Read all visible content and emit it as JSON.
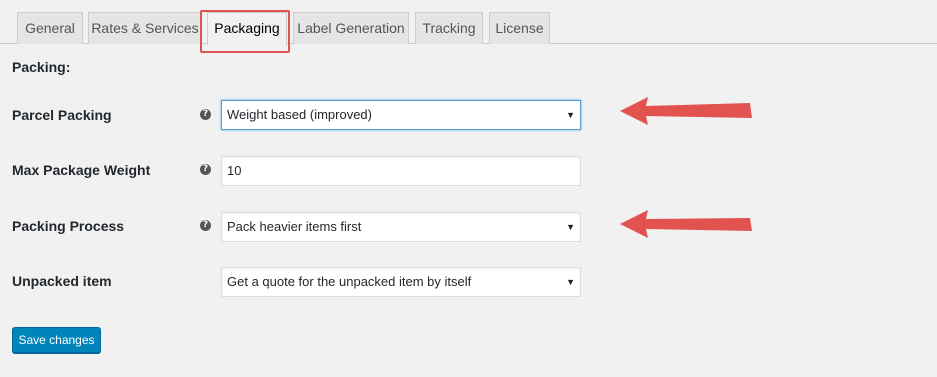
{
  "tabs": [
    {
      "label": "General"
    },
    {
      "label": "Rates & Services"
    },
    {
      "label": "Packaging",
      "active": true
    },
    {
      "label": "Label Generation"
    },
    {
      "label": "Tracking"
    },
    {
      "label": "License"
    }
  ],
  "section_title": "Packing:",
  "fields": {
    "parcel_packing": {
      "label": "Parcel Packing",
      "value": "Weight based (improved)"
    },
    "max_package_weight": {
      "label": "Max Package Weight",
      "value": "10"
    },
    "packing_process": {
      "label": "Packing Process",
      "value": "Pack heavier items first"
    },
    "unpacked_item": {
      "label": "Unpacked item",
      "value": "Get a quote for the unpacked item by itself"
    }
  },
  "help_glyph": "?",
  "caret_glyph": "▼",
  "save_button": "Save changes",
  "colors": {
    "accent": "#0085ba",
    "annotation": "#e2524f"
  }
}
